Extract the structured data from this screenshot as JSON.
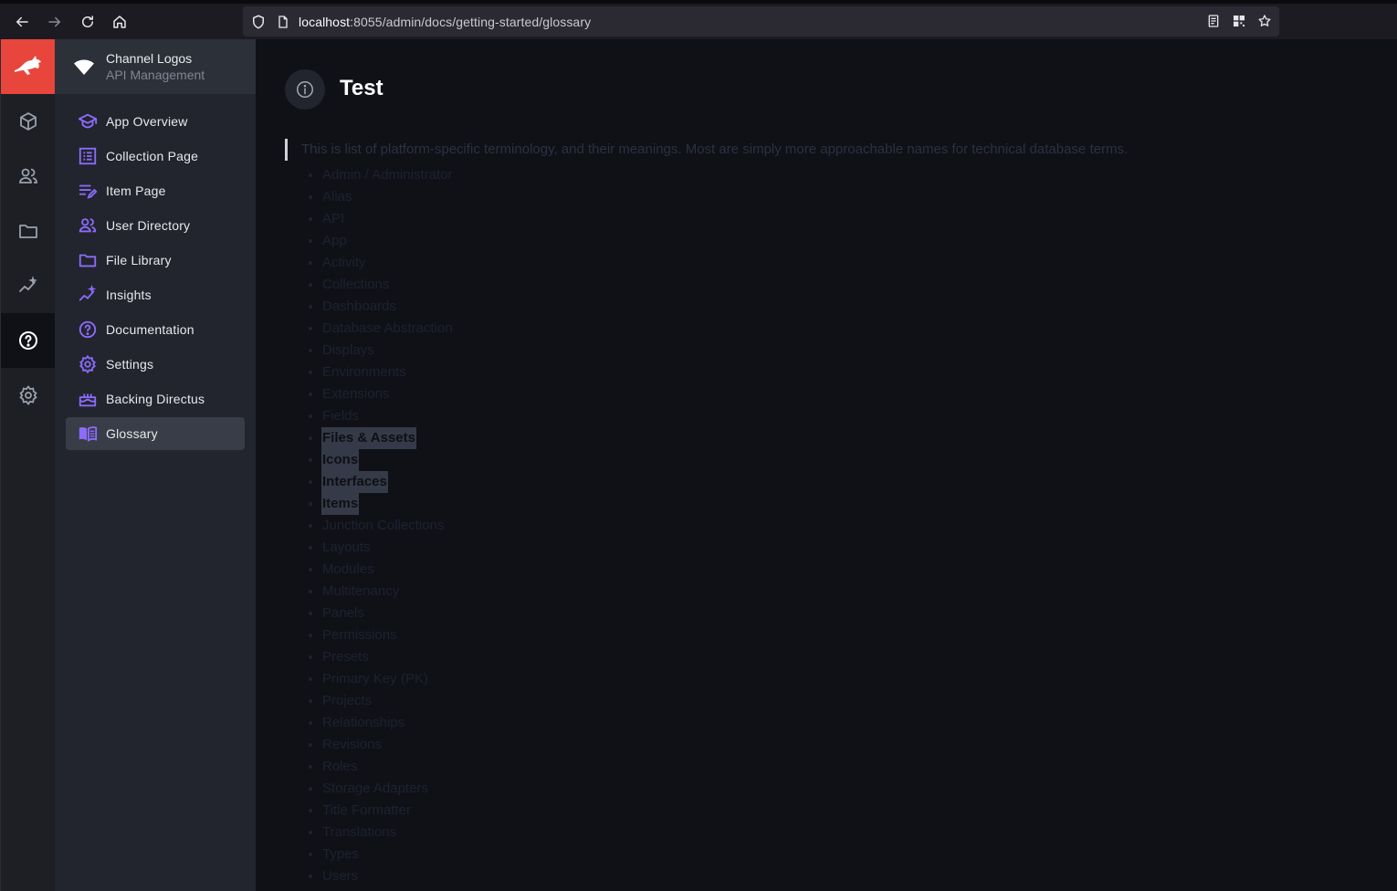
{
  "browser": {
    "url_host": "localhost",
    "url_path": ":8055/admin/docs/getting-started/glossary"
  },
  "project": {
    "name": "Channel Logos",
    "subtitle": "API Management"
  },
  "modules": [
    {
      "icon": "content-icon"
    },
    {
      "icon": "users-icon"
    },
    {
      "icon": "files-icon"
    },
    {
      "icon": "insights-icon"
    },
    {
      "icon": "help-icon",
      "active": true
    },
    {
      "icon": "settings-icon"
    }
  ],
  "nav": {
    "items": [
      {
        "label": "App Overview",
        "icon": "school-icon"
      },
      {
        "label": "Collection Page",
        "icon": "list-icon"
      },
      {
        "label": "Item Page",
        "icon": "edit-note-icon"
      },
      {
        "label": "User Directory",
        "icon": "people-icon"
      },
      {
        "label": "File Library",
        "icon": "folder-icon"
      },
      {
        "label": "Insights",
        "icon": "insights-icon"
      },
      {
        "label": "Documentation",
        "icon": "help-icon"
      },
      {
        "label": "Settings",
        "icon": "gear-icon"
      },
      {
        "label": "Backing Directus",
        "icon": "cake-icon"
      },
      {
        "label": "Glossary",
        "icon": "book-icon",
        "active": true
      }
    ]
  },
  "main": {
    "title": "Test",
    "intro": "This is list of platform-specific terminology, and their meanings. Most are simply more approachable names for technical database terms.",
    "terms": [
      "Admin / Administrator",
      "Alias",
      "API",
      "App",
      "Activity",
      "Collections",
      "Dashboards",
      "Database Abstraction",
      "Displays",
      "Environments",
      "Extensions",
      "Fields",
      "Files & Assets",
      "Icons",
      "Interfaces",
      "Items",
      "Junction Collections",
      "Layouts",
      "Modules",
      "Multitenancy",
      "Panels",
      "Permissions",
      "Presets",
      "Primary Key (PK)",
      "Projects",
      "Relationships",
      "Revisions",
      "Roles",
      "Storage Adapters",
      "Title Formatter",
      "Translations",
      "Types",
      "Users"
    ],
    "selected_terms": [
      12,
      13,
      14,
      15
    ]
  },
  "colors": {
    "accent": "#8d6bff",
    "logo_bg": "#e8453c"
  }
}
